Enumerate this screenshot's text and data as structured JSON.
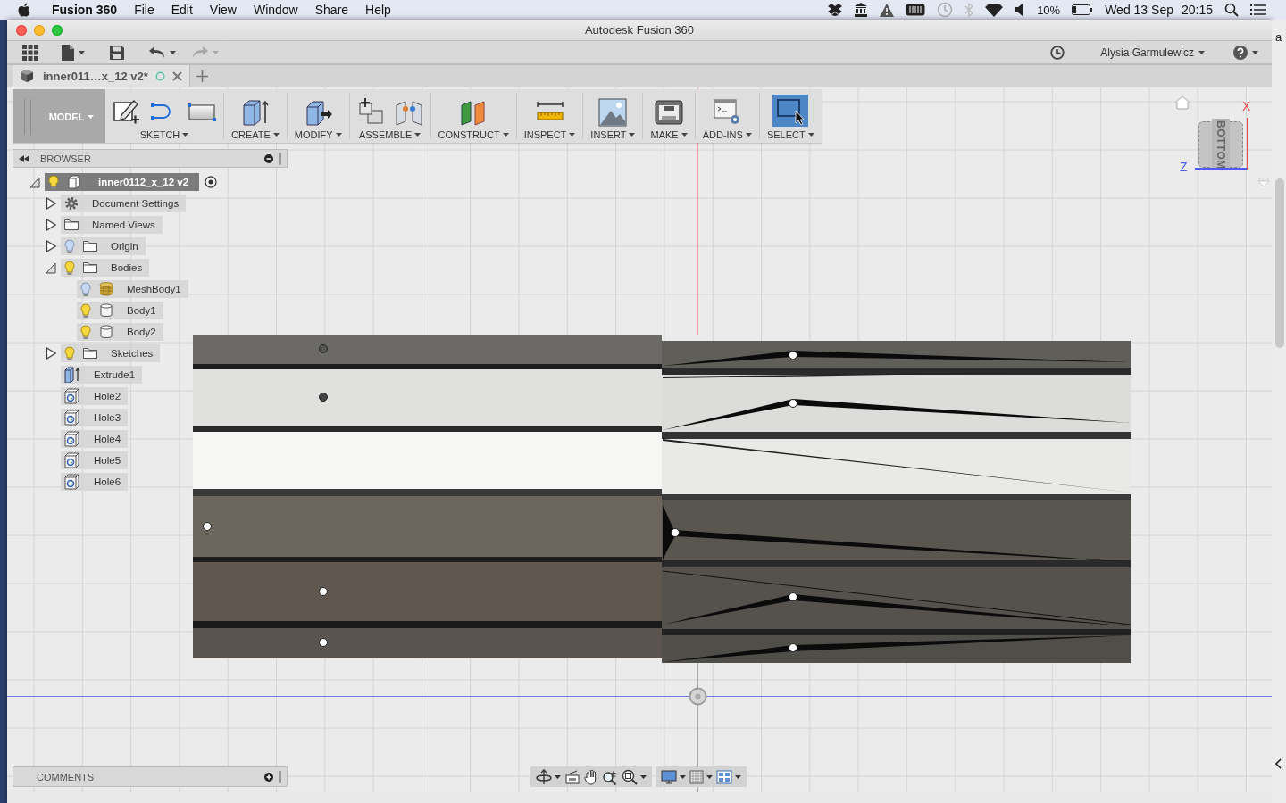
{
  "menubar": {
    "app_name": "Fusion 360",
    "menus": [
      "File",
      "Edit",
      "View",
      "Window",
      "Share",
      "Help"
    ],
    "battery": "10%",
    "date": "Wed 13 Sep",
    "time": "20:15"
  },
  "window": {
    "title": "Autodesk Fusion 360"
  },
  "quick_toolbar": {
    "user": "Alysia Garmulewicz",
    "redo_disabled": true
  },
  "doc_tabs": [
    {
      "label": "inner011…x_12 v2*",
      "selected": true
    }
  ],
  "ribbon": {
    "workspace": "MODEL",
    "groups": [
      {
        "label": "SKETCH",
        "active": false
      },
      {
        "label": "CREATE",
        "active": false
      },
      {
        "label": "MODIFY",
        "active": false
      },
      {
        "label": "ASSEMBLE",
        "active": false
      },
      {
        "label": "CONSTRUCT",
        "active": false
      },
      {
        "label": "INSPECT",
        "active": false
      },
      {
        "label": "INSERT",
        "active": false
      },
      {
        "label": "MAKE",
        "active": false
      },
      {
        "label": "ADD-INS",
        "active": false
      },
      {
        "label": "SELECT",
        "active": true
      }
    ]
  },
  "browser": {
    "title": "BROWSER",
    "tree": [
      {
        "label": "inner0112_x_12 v2",
        "kind": "component",
        "visible": true,
        "expanded": true,
        "selected": true,
        "activated": true,
        "children": [
          {
            "label": "Document Settings",
            "kind": "settings",
            "expanded": false,
            "selected": false
          },
          {
            "label": "Named Views",
            "kind": "folder",
            "expanded": false,
            "selected": false
          },
          {
            "label": "Origin",
            "kind": "folder",
            "visible": false,
            "expanded": false,
            "selected": false
          },
          {
            "label": "Bodies",
            "kind": "folder",
            "visible": true,
            "expanded": true,
            "selected": false,
            "children": [
              {
                "label": "MeshBody1",
                "kind": "mesh",
                "visible": false,
                "selected": false
              },
              {
                "label": "Body1",
                "kind": "body",
                "visible": true,
                "selected": false
              },
              {
                "label": "Body2",
                "kind": "body",
                "visible": true,
                "selected": false
              }
            ]
          },
          {
            "label": "Sketches",
            "kind": "folder",
            "visible": true,
            "expanded": false,
            "selected": false
          },
          {
            "label": "Extrude1",
            "kind": "extrude",
            "selected": false
          },
          {
            "label": "Hole2",
            "kind": "hole",
            "selected": false
          },
          {
            "label": "Hole3",
            "kind": "hole",
            "selected": false
          },
          {
            "label": "Hole4",
            "kind": "hole",
            "selected": false
          },
          {
            "label": "Hole5",
            "kind": "hole",
            "selected": false
          },
          {
            "label": "Hole6",
            "kind": "hole",
            "selected": false
          }
        ]
      }
    ]
  },
  "viewcube": {
    "face": "BOTTOM",
    "axis_labels": [
      "X",
      "Z"
    ]
  },
  "comments": {
    "title": "COMMENTS"
  },
  "behind_window": {
    "text_fragment": "a"
  }
}
